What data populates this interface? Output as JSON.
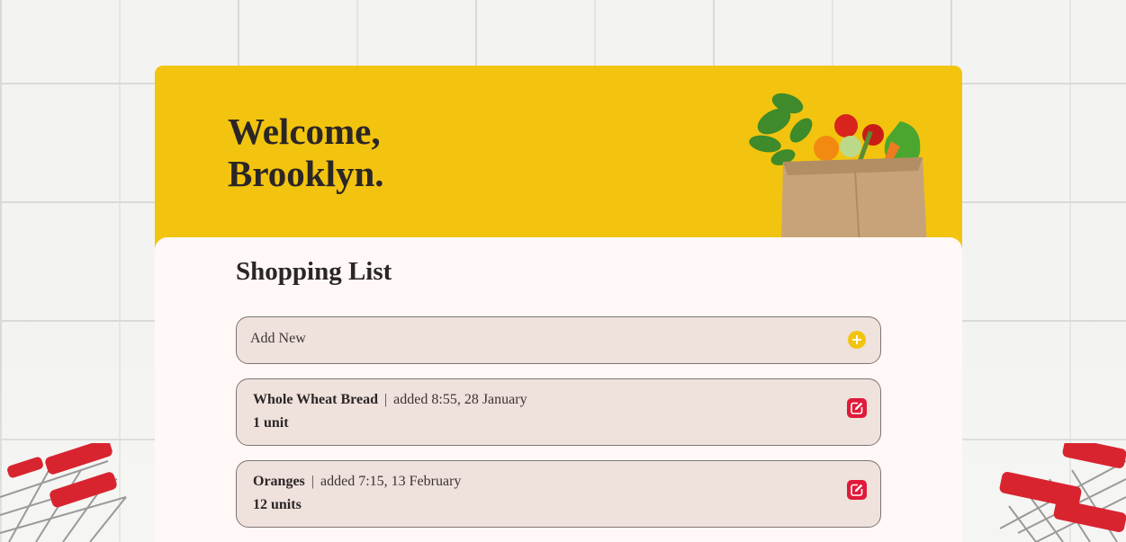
{
  "header": {
    "greeting_line1": "Welcome,",
    "greeting_line2": "Brooklyn."
  },
  "shopping_list": {
    "title": "Shopping List",
    "add_new": {
      "placeholder": "Add New",
      "icon": "plus-circle-icon"
    },
    "items": [
      {
        "name": "Whole Wheat Bread",
        "separator": "|",
        "added": "added 8:55, 28 January",
        "quantity": "1 unit",
        "icon": "edit-icon"
      },
      {
        "name": "Oranges",
        "separator": "|",
        "added": "added 7:15, 13 February",
        "quantity": "12 units",
        "icon": "edit-icon"
      }
    ]
  },
  "colors": {
    "accent_yellow": "#f2c40f",
    "edit_red": "#e01a3a",
    "card_bg": "#fff8f7",
    "row_bg": "#efe1dc"
  }
}
